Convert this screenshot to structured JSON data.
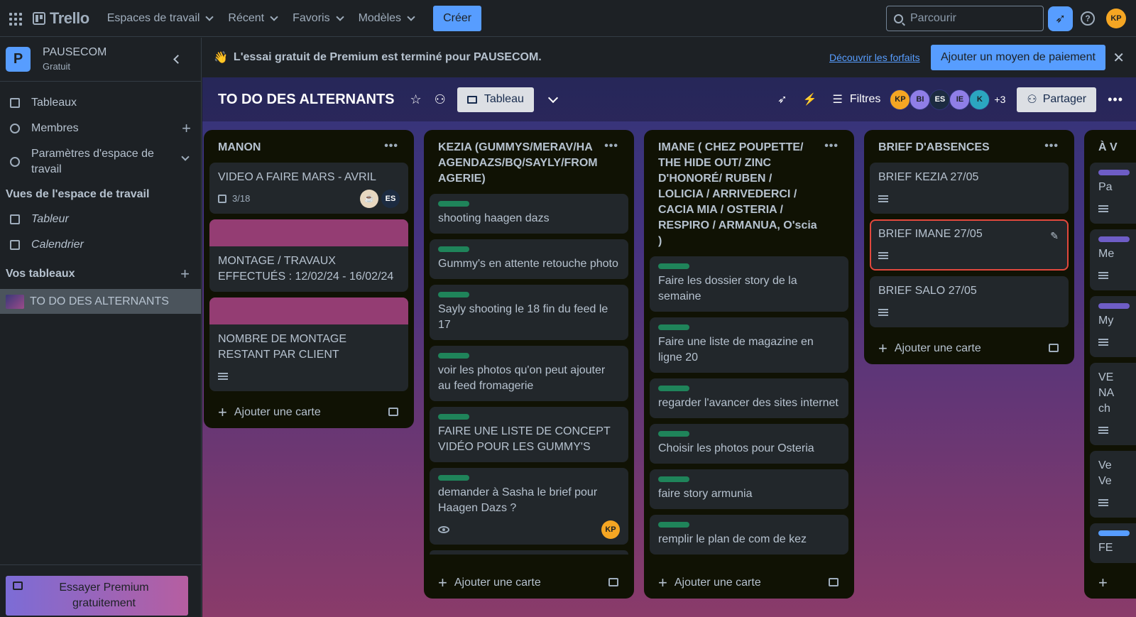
{
  "topbar": {
    "app_name": "Trello",
    "nav": [
      "Espaces de travail",
      "Récent",
      "Favoris",
      "Modèles"
    ],
    "create_label": "Créer",
    "search_placeholder": "Parcourir",
    "user_initials": "KP"
  },
  "sidebar": {
    "workspace_initial": "P",
    "workspace_name": "PAUSECOM",
    "workspace_plan": "Gratuit",
    "items": [
      {
        "label": "Tableaux",
        "icon": "board-icon"
      },
      {
        "label": "Membres",
        "icon": "member-icon"
      },
      {
        "label": "Paramètres d'espace de travail",
        "icon": "settings-icon"
      }
    ],
    "views_title": "Vues de l'espace de travail",
    "views": [
      "Tableur",
      "Calendrier"
    ],
    "boards_title": "Vos tableaux",
    "boards": [
      "TO DO DES ALTERNANTS"
    ],
    "premium_label": "Essayer Premium gratuitement"
  },
  "banner": {
    "emoji": "👋",
    "text": "L'essai gratuit de Premium est terminé pour PAUSECOM.",
    "link": "Découvrir les forfaits",
    "button": "Ajouter un moyen de paiement"
  },
  "board": {
    "title": "TO DO DES ALTERNANTS",
    "view_label": "Tableau",
    "filters_label": "Filtres",
    "members": [
      {
        "initials": "KP",
        "color": "#f5a623"
      },
      {
        "initials": "BI",
        "color": "#8f7ee7"
      },
      {
        "initials": "ES",
        "color": "#1c2b41"
      },
      {
        "initials": "IE",
        "color": "#8f7ee7"
      },
      {
        "initials": "K",
        "color": "#2ba6c0"
      }
    ],
    "extra_members": "+3",
    "share_label": "Partager",
    "add_card_label": "Ajouter une carte"
  },
  "lists": [
    {
      "title": "MANON",
      "cards": [
        {
          "title": "VIDEO A FAIRE MARS - AVRIL",
          "checklist": "3/18",
          "avatars": [
            "ES"
          ]
        },
        {
          "title": "MONTAGE / TRAVAUX EFFECTUÉS : 12/02/24 - 16/02/24",
          "cover": "#943d73"
        },
        {
          "title": "NOMBRE DE MONTAGE RESTANT PAR CLIENT",
          "cover": "#943d73",
          "description": true
        }
      ]
    },
    {
      "title": "KEZIA (GUMMYS/MERAV/HAAGENDAZS/BQ/SAYLY/FROMAGERIE)",
      "cards": [
        {
          "title": "shooting haagen dazs",
          "label": "#1f845a"
        },
        {
          "title": "Gummy's en attente retouche photo",
          "label": "#1f845a"
        },
        {
          "title": "Sayly shooting le 18 fin du feed le 17",
          "label": "#1f845a"
        },
        {
          "title": "voir les photos qu'on peut ajouter au feed fromagerie",
          "label": "#1f845a"
        },
        {
          "title": "FAIRE UNE LISTE DE CONCEPT VIDÉO POUR LES GUMMY'S",
          "label": "#1f845a"
        },
        {
          "title": "demander à Sasha le brief pour Haagen Dazs ?",
          "label": "#1f845a",
          "watch": true,
          "avatars": [
            "KP"
          ]
        }
      ]
    },
    {
      "title": "IMANE ( CHEZ POUPETTE/ THE HIDE OUT/ ZINC D'HONORÉ/ RUBEN / LOLICIA / ARRIVEDERCI / CACIA MIA / OSTERIA / RESPIRO / ARMANUA, O'scia )",
      "cards": [
        {
          "title": "Faire les dossier story de la semaine",
          "label": "#1f845a"
        },
        {
          "title": "Faire une liste de magazine en ligne 20",
          "label": "#1f845a"
        },
        {
          "title": "regarder l'avancer des sites internet",
          "label": "#1f845a"
        },
        {
          "title": "Choisir les photos pour Osteria",
          "label": "#1f845a"
        },
        {
          "title": "faire story armunia",
          "label": "#1f845a"
        },
        {
          "title": "remplir le plan de com de kez",
          "label": "#1f845a"
        }
      ]
    },
    {
      "title": "BRIEF D'ABSENCES",
      "cards": [
        {
          "title": "BRIEF KEZIA 27/05",
          "description": true
        },
        {
          "title": "BRIEF IMANE 27/05",
          "description": true,
          "selected": true
        },
        {
          "title": "BRIEF SALO 27/05",
          "description": true
        }
      ]
    },
    {
      "title": "À V",
      "cards": [
        {
          "title": "Pa"
        },
        {
          "title": "Me"
        },
        {
          "title": "My"
        },
        {
          "title": "VE NA ch"
        },
        {
          "title": "Ve Ve"
        },
        {
          "title": "FE"
        }
      ]
    }
  ]
}
